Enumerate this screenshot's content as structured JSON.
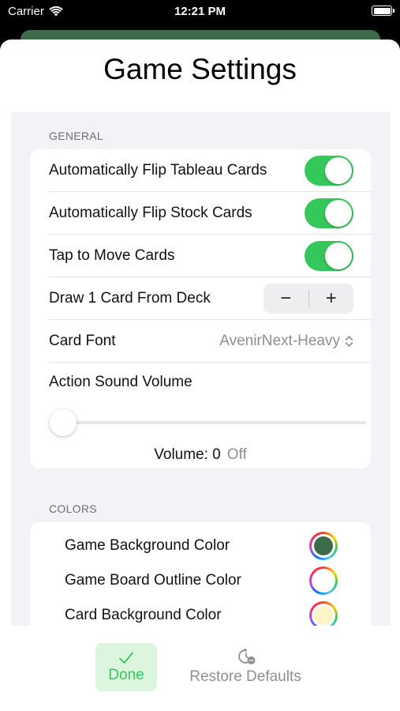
{
  "status_bar": {
    "carrier": "Carrier",
    "time": "12:21 PM"
  },
  "sheet": {
    "title": "Game Settings"
  },
  "general": {
    "header": "GENERAL",
    "rows": {
      "flip_tableau": {
        "label": "Automatically Flip Tableau Cards",
        "on": true
      },
      "flip_stock": {
        "label": "Automatically Flip Stock Cards",
        "on": true
      },
      "tap_to_move": {
        "label": "Tap to Move Cards",
        "on": true
      },
      "draw": {
        "label": "Draw 1 Card From Deck",
        "minus": "−",
        "plus": "+"
      },
      "card_font": {
        "label": "Card Font",
        "value": "AvenirNext-Heavy"
      },
      "action_sound": {
        "label": "Action Sound Volume",
        "value": 0
      }
    },
    "volume_label": "Volume: 0",
    "volume_state": "Off"
  },
  "colors": {
    "header": "COLORS",
    "items": [
      {
        "label": "Game Background Color",
        "swatch": "#3d6b4a"
      },
      {
        "label": "Game Board Outline Color",
        "swatch": "#ffffff"
      },
      {
        "label": "Card Background Color",
        "swatch": "#fdf3c8"
      }
    ]
  },
  "toolbar": {
    "done_label": "Done",
    "restore_label": "Restore Defaults"
  },
  "theme": {
    "toggle_on": "#34c759",
    "accent_green": "#34c759"
  }
}
